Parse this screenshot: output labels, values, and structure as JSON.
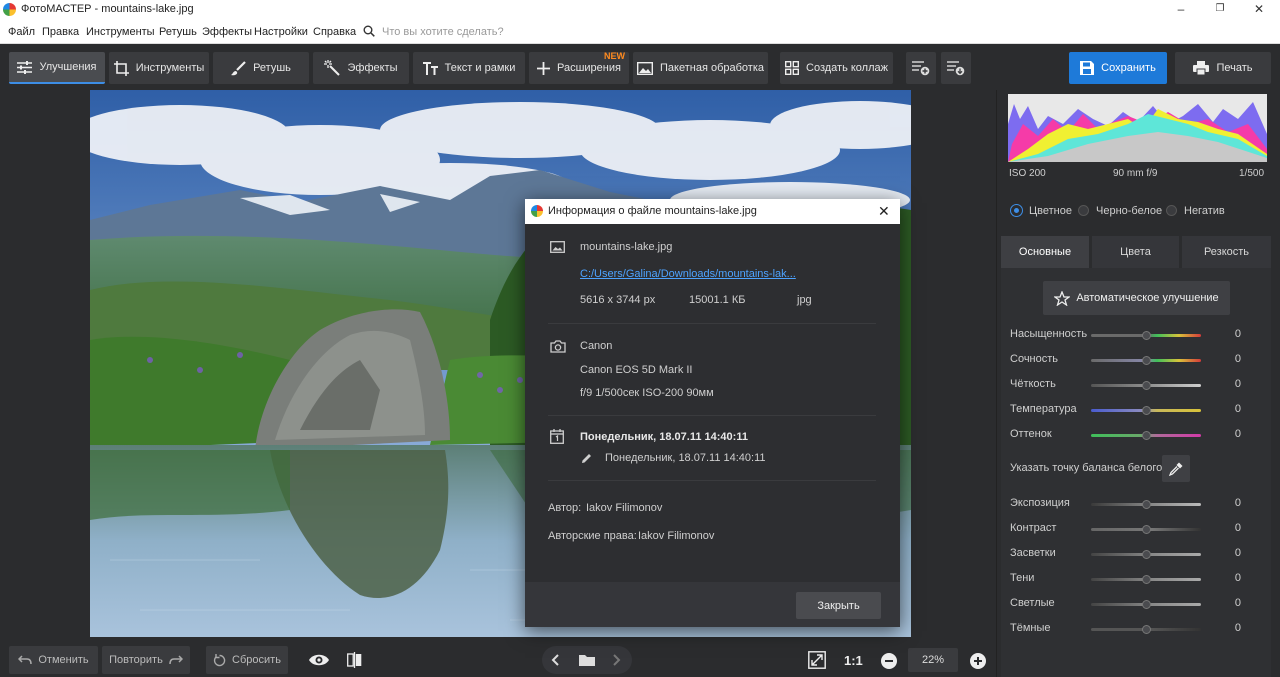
{
  "window": {
    "title": "ФотоМАСТЕР - mountains-lake.jpg"
  },
  "menu": {
    "items": [
      "Файл",
      "Правка",
      "Инструменты",
      "Ретушь",
      "Эффекты",
      "Настройки",
      "Справка"
    ],
    "search_placeholder": "Что вы хотите сделать?"
  },
  "toolbar": {
    "enhance": "Улучшения",
    "tools": "Инструменты",
    "retouch": "Ретушь",
    "effects": "Эффекты",
    "text_frames": "Текст и рамки",
    "extensions": "Расширения",
    "new_badge": "NEW",
    "batch": "Пакетная обработка",
    "collage": "Создать коллаж",
    "save": "Сохранить",
    "print": "Печать"
  },
  "histogram": {
    "iso": "ISO 200",
    "lens": "90 mm f/9",
    "shutter": "1/500"
  },
  "color_modes": {
    "color": "Цветное",
    "bw": "Черно-белое",
    "negative": "Негатив",
    "selected": "color"
  },
  "tabs": {
    "basic": "Основные",
    "colors": "Цвета",
    "sharpness": "Резкость",
    "active": "basic"
  },
  "auto_enhance": "Автоматическое улучшение",
  "white_balance_label": "Указать точку баланса белого",
  "sliders_top": [
    {
      "label": "Насыщенность",
      "value": "0"
    },
    {
      "label": "Сочность",
      "value": "0"
    },
    {
      "label": "Чёткость",
      "value": "0"
    },
    {
      "label": "Температура",
      "value": "0"
    },
    {
      "label": "Оттенок",
      "value": "0"
    }
  ],
  "sliders_bottom": [
    {
      "label": "Экспозиция",
      "value": "0"
    },
    {
      "label": "Контраст",
      "value": "0"
    },
    {
      "label": "Засветки",
      "value": "0"
    },
    {
      "label": "Тени",
      "value": "0"
    },
    {
      "label": "Светлые",
      "value": "0"
    },
    {
      "label": "Тёмные",
      "value": "0"
    }
  ],
  "bottom": {
    "undo": "Отменить",
    "redo": "Повторить",
    "reset": "Сбросить",
    "ratio": "1:1",
    "zoom": "22%"
  },
  "dialog": {
    "title": "Информация о файле mountains-lake.jpg",
    "filename": "mountains-lake.jpg",
    "path": "C:/Users/Galina/Downloads/mountains-lak...",
    "dimensions": "5616 x 3744 px",
    "size": "15001.1 КБ",
    "format": "jpg",
    "camera_make": "Canon",
    "camera_model": "Canon EOS 5D Mark II",
    "exposure": "f/9 1/500сек  ISO-200  90мм",
    "date_created": "Понедельник,  18.07.11  14:40:11",
    "date_modified": "Понедельник,  18.07.11  14:40:11",
    "author_label": "Автор:",
    "author": "Iakov Filimonov",
    "copyright_label": "Авторские права:",
    "copyright": "Iakov Filimonov",
    "close": "Закрыть"
  },
  "colors": {
    "accent": "#1e7ad9",
    "new_badge": "#ff8a1f"
  }
}
